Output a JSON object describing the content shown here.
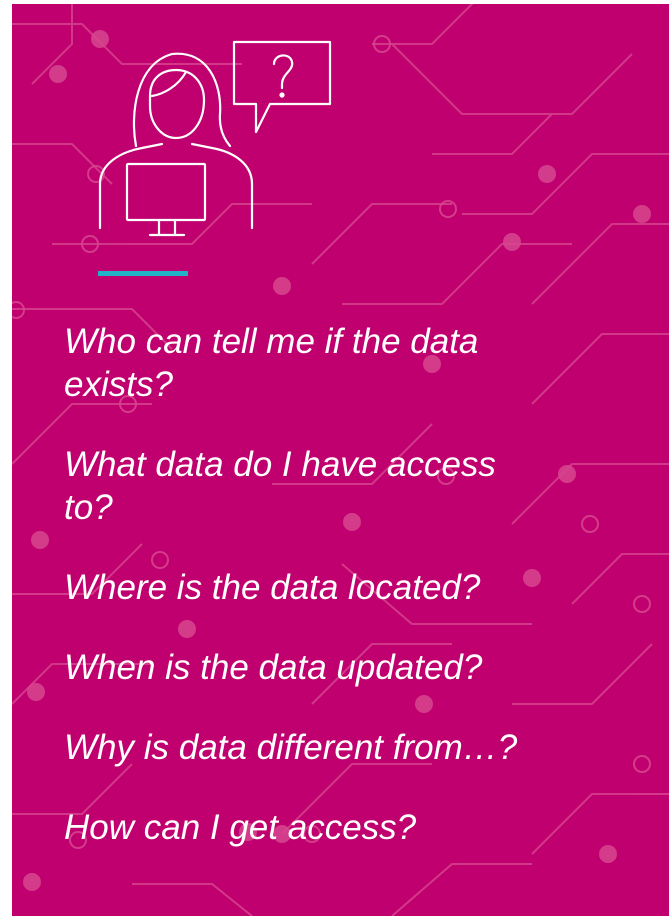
{
  "illustration": {
    "icon": "person-at-computer-with-question-bubble-icon",
    "bubble_glyph": "?"
  },
  "colors": {
    "background": "#c0006f",
    "accent": "#22b3c8",
    "text": "#ffffff"
  },
  "questions": [
    "Who can tell me if the data exists?",
    "What data do I have access to?",
    "Where is the data located?",
    "When is the data updated?",
    "Why is data different from…?",
    "How can I get access?"
  ]
}
